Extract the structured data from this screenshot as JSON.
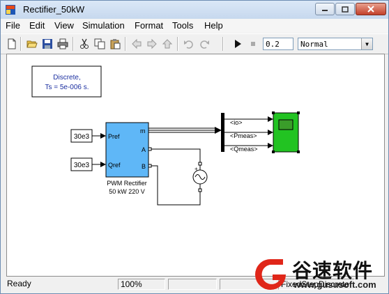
{
  "window": {
    "title": "Rectifier_50kW"
  },
  "menu": [
    "File",
    "Edit",
    "View",
    "Simulation",
    "Format",
    "Tools",
    "Help"
  ],
  "toolbar": {
    "stop_time": "0.2",
    "sim_mode": "Normal",
    "icons": [
      "new-icon",
      "open-icon",
      "save-icon",
      "print-icon",
      "cut-icon",
      "copy-icon",
      "paste-icon",
      "back-icon",
      "forward-icon",
      "up-icon",
      "undo-icon",
      "redo-icon",
      "play-icon",
      "stop-icon"
    ]
  },
  "model": {
    "powergui_line1": "Discrete,",
    "powergui_line2": "Ts = 5e-006 s.",
    "const1": "30e3",
    "const2": "30e3",
    "pwm_port_pref": "Pref",
    "pwm_port_qref": "Qref",
    "pwm_port_m": "m",
    "pwm_port_a": "A",
    "pwm_port_b": "B",
    "pwm_name_line1": "PWM Rectifier",
    "pwm_name_line2": "50 kW 220 V",
    "sig_io": "<io>",
    "sig_pmeas": "<Pmeas>",
    "sig_qmeas": "<Qmeas>",
    "colors": {
      "pwm_block": "#5fb7f7",
      "scope_block": "#22c322",
      "annotation": "#1b2fa0"
    }
  },
  "status": {
    "state": "Ready",
    "zoom": "100%",
    "solver": "FixedStepDiscrete"
  },
  "watermark": {
    "brand": "谷速软件",
    "url": "www.gususoft.com"
  }
}
